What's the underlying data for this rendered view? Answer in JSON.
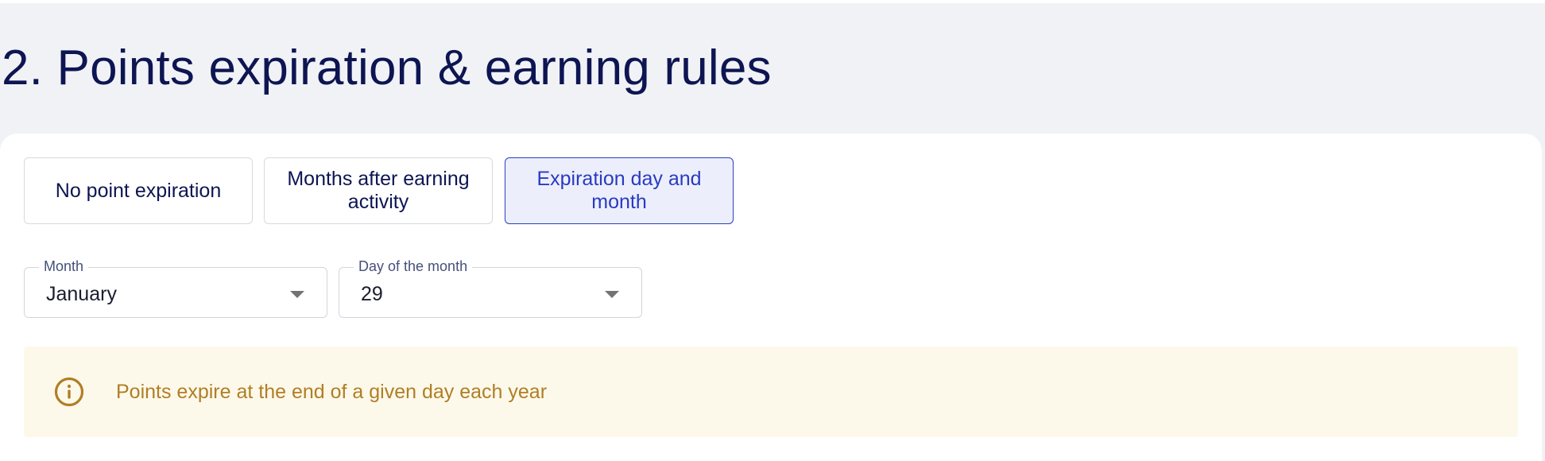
{
  "section": {
    "title": "2. Points expiration & earning rules"
  },
  "expiration_options": [
    {
      "label": "No point expiration",
      "selected": false
    },
    {
      "label": "Months after earning activity",
      "selected": false
    },
    {
      "label": "Expiration day and month",
      "selected": true
    }
  ],
  "month_field": {
    "label": "Month",
    "value": "January",
    "icon": "chevron-down-icon"
  },
  "day_field": {
    "label": "Day of the month",
    "value": "29",
    "icon": "chevron-down-icon"
  },
  "info_banner": {
    "icon": "info-circle-icon",
    "text": "Points expire at the end of a given day each year"
  },
  "colors": {
    "page_background": "#f1f2f6",
    "title": "#0d1552",
    "selected_accent": "#2a3ac2",
    "selected_background": "#eceffb",
    "info_background": "#fdf9ea",
    "info_text": "#b07e26"
  }
}
